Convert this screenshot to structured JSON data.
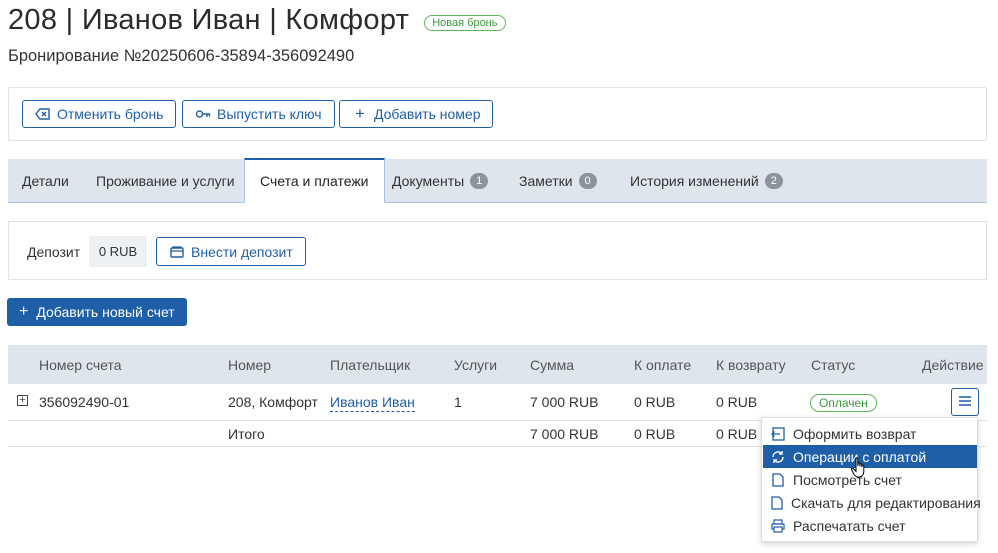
{
  "header": {
    "title": "208 | Иванов Иван | Комфорт",
    "badge": "Новая бронь",
    "subtitle": "Бронирование №20250606-35894-356092490"
  },
  "actions": {
    "cancel": "Отменить бронь",
    "issue_key": "Выпустить ключ",
    "add_room": "Добавить номер"
  },
  "tabs": [
    {
      "label": "Детали"
    },
    {
      "label": "Проживание и услуги"
    },
    {
      "label": "Счета и платежи",
      "active": true
    },
    {
      "label": "Документы",
      "count": "1"
    },
    {
      "label": "Заметки",
      "count": "0"
    },
    {
      "label": "История изменений",
      "count": "2"
    }
  ],
  "deposit": {
    "label": "Депозит",
    "value": "0 RUB",
    "button": "Внести депозит"
  },
  "add_invoice": "Добавить новый счет",
  "table": {
    "headers": [
      "Номер счета",
      "Номер",
      "Плательщик",
      "Услуги",
      "Сумма",
      "К оплате",
      "К возврату",
      "Статус",
      "Действие"
    ],
    "rows": [
      {
        "invoice": "356092490-01",
        "room": "208, Комфорт",
        "payer": "Иванов Иван",
        "services": "1",
        "sum": "7 000 RUB",
        "to_pay": "0 RUB",
        "refund": "0 RUB",
        "status": "Оплачен"
      }
    ],
    "total": {
      "label": "Итого",
      "sum": "7 000 RUB",
      "to_pay": "0 RUB",
      "refund": "0 RUB"
    }
  },
  "dropdown": {
    "items": [
      {
        "label": "Оформить возврат",
        "icon": "refund-icon"
      },
      {
        "label": "Операции с оплатой",
        "icon": "sync-icon",
        "highlighted": true
      },
      {
        "label": "Посмотреть счет",
        "icon": "document-icon"
      },
      {
        "label": "Скачать для редактирования",
        "icon": "document-icon"
      },
      {
        "label": "Распечатать счет",
        "icon": "printer-icon"
      }
    ]
  },
  "colors": {
    "accent": "#1f5fa8",
    "status_green": "#5cb85c",
    "tab_bar": "#dfe5ec"
  }
}
